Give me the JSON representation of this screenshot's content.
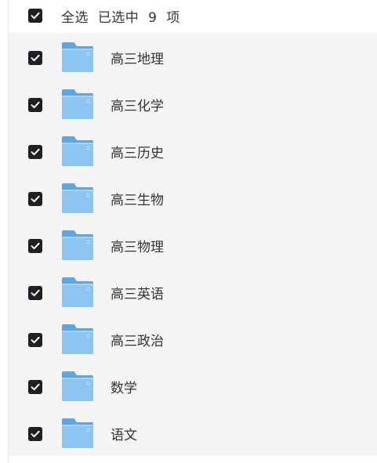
{
  "header": {
    "select_all_label": "全选",
    "selected_prefix": "已选中",
    "selected_count": "9",
    "selected_suffix": "项",
    "checked": true
  },
  "colors": {
    "checkbox_fill": "#1f1f23",
    "folder_front": "#8cc4f2",
    "folder_back": "#5aa7e8",
    "list_background": "#f4f4f4"
  },
  "items": [
    {
      "name": "高三地理",
      "checked": true,
      "icon": "folder-icon"
    },
    {
      "name": "高三化学",
      "checked": true,
      "icon": "folder-icon"
    },
    {
      "name": "高三历史",
      "checked": true,
      "icon": "folder-icon"
    },
    {
      "name": "高三生物",
      "checked": true,
      "icon": "folder-icon"
    },
    {
      "name": "高三物理",
      "checked": true,
      "icon": "folder-icon"
    },
    {
      "name": "高三英语",
      "checked": true,
      "icon": "folder-icon"
    },
    {
      "name": "高三政治",
      "checked": true,
      "icon": "folder-icon"
    },
    {
      "name": "数学",
      "checked": true,
      "icon": "folder-icon"
    },
    {
      "name": "语文",
      "checked": true,
      "icon": "folder-icon"
    }
  ]
}
